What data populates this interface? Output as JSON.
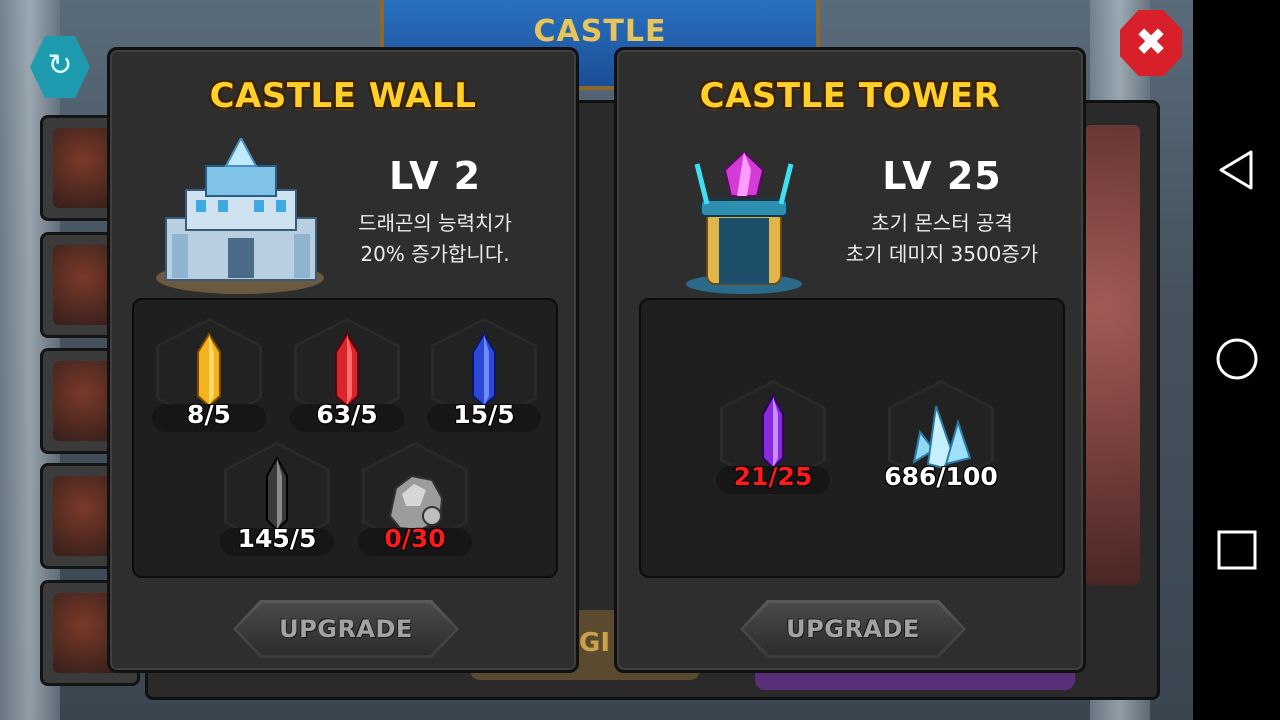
{
  "background": {
    "banner_title": "CASTLE",
    "upgrade_fragment": "PGI"
  },
  "panels": {
    "wall": {
      "title": "CASTLE WALL",
      "level": "LV 2",
      "desc_line1": "드래곤의 능력치가",
      "desc_line2": "20% 증가합니다.",
      "items": [
        {
          "icon": "yellow-crystal-icon",
          "count": "8/5",
          "insufficient": false
        },
        {
          "icon": "red-crystal-icon",
          "count": "63/5",
          "insufficient": false
        },
        {
          "icon": "blue-crystal-icon",
          "count": "15/5",
          "insufficient": false
        },
        {
          "icon": "black-crystal-icon",
          "count": "145/5",
          "insufficient": false
        },
        {
          "icon": "stone-ore-icon",
          "count": "0/30",
          "insufficient": true
        }
      ],
      "upgrade_label": "UPGRADE"
    },
    "tower": {
      "title": "CASTLE TOWER",
      "level": "LV 25",
      "desc_line1": "초기 몬스터 공격",
      "desc_line2": "초기 데미지 3500증가",
      "items": [
        {
          "icon": "purple-crystal-icon",
          "count": "21/25",
          "insufficient": true
        },
        {
          "icon": "ice-crystal-cluster-icon",
          "count": "686/100",
          "insufficient": false
        }
      ],
      "upgrade_label": "UPGRADE"
    }
  },
  "controls": {
    "close_icon": "close-icon",
    "refresh_icon": "refresh-icon"
  },
  "navbar": {
    "back_icon": "back-triangle-icon",
    "home_icon": "home-circle-icon",
    "recents_icon": "recents-square-icon"
  },
  "colors": {
    "title_gold": "#ffd02a",
    "insufficient_red": "#ff1a1a",
    "close_red": "#d8202b",
    "refresh_teal": "#1f9bb0"
  }
}
